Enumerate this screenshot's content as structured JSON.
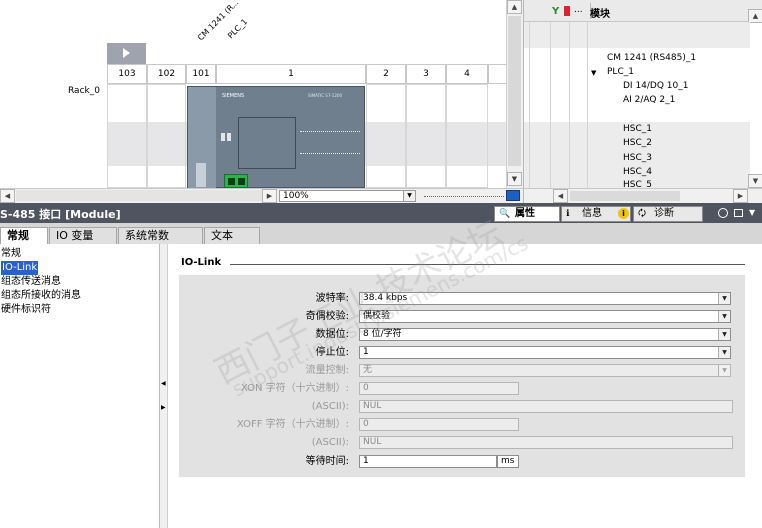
{
  "device_view": {
    "rotated_labels": [
      "CM 1241 (R...",
      "PLC_1"
    ],
    "slots": [
      "103",
      "102",
      "101",
      "1",
      "2",
      "3",
      "4"
    ],
    "rack_label": "Rack_0",
    "plc_brand": "SIEMENS",
    "plc_model": "SIMATIC S7-1200",
    "zoom": "100%"
  },
  "module_list": {
    "header": "模块",
    "header_dots": "...",
    "items": [
      {
        "label": "CM 1241 (RS485)_1",
        "indent": 0
      },
      {
        "label": "PLC_1",
        "indent": 0,
        "expanded": true
      },
      {
        "label": "DI 14/DQ 10_1",
        "indent": 1
      },
      {
        "label": "AI 2/AQ 2_1",
        "indent": 1
      },
      {
        "label": "HSC_1",
        "indent": 1
      },
      {
        "label": "HSC_2",
        "indent": 1
      },
      {
        "label": "HSC_3",
        "indent": 1
      },
      {
        "label": "HSC_4",
        "indent": 1
      },
      {
        "label": "HSC_5",
        "indent": 1
      }
    ]
  },
  "inspector": {
    "title": "S-485 接口 [Module]",
    "tabs": [
      {
        "label": "属性",
        "icon": "properties-icon",
        "active": true
      },
      {
        "label": "信息",
        "icon": "info-icon",
        "active": false
      },
      {
        "label": "诊断",
        "icon": "diagnostics-icon",
        "active": false
      }
    ]
  },
  "main_tabs": [
    "常规",
    "IO 变量",
    "系统常数",
    "文本"
  ],
  "left_nav": [
    "常规",
    "IO-Link",
    "组态传送消息",
    "组态所接收的消息",
    "硬件标识符"
  ],
  "section": {
    "title": "IO-Link",
    "params": [
      {
        "label": "波特率:",
        "value": "38.4 kbps",
        "type": "select",
        "enabled": true
      },
      {
        "label": "奇偶校验:",
        "value": "偶校验",
        "type": "select",
        "enabled": true
      },
      {
        "label": "数据位:",
        "value": "8 位/字符",
        "type": "select",
        "enabled": true
      },
      {
        "label": "停止位:",
        "value": "1",
        "type": "select",
        "enabled": true
      },
      {
        "label": "流量控制:",
        "value": "无",
        "type": "select",
        "enabled": false
      },
      {
        "label": "XON 字符（十六进制）:",
        "value": "0",
        "type": "text",
        "enabled": false
      },
      {
        "label": "(ASCII):",
        "value": "NUL",
        "type": "text",
        "enabled": false
      },
      {
        "label": "XOFF 字符（十六进制）:",
        "value": "0",
        "type": "text",
        "enabled": false
      },
      {
        "label": "(ASCII):",
        "value": "NUL",
        "type": "text",
        "enabled": false
      },
      {
        "label": "等待时间:",
        "value": "1",
        "type": "text",
        "enabled": true,
        "unit": "ms"
      }
    ]
  },
  "watermark": {
    "line1": "西门子工业 技术论坛",
    "line2": "support.industry.siemens.com/cs"
  },
  "colors": {
    "selection": "#2a62c9",
    "inspector_bar": "#4e5560",
    "panel_bg": "#e2e2e2",
    "connector_green": "#2bb34a"
  }
}
